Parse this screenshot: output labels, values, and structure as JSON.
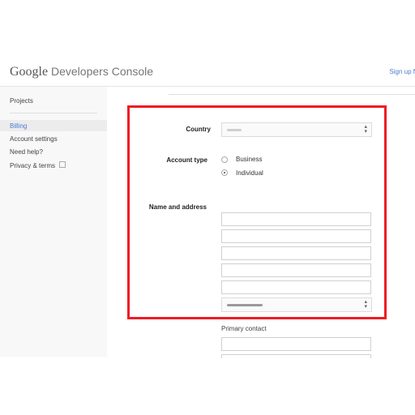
{
  "header": {
    "brand_google": "Google",
    "brand_rest": " Developers Console",
    "signup": "Sign up f"
  },
  "sidebar": {
    "items": [
      {
        "label": "Projects"
      },
      {
        "label": "Billing"
      },
      {
        "label": "Account settings"
      },
      {
        "label": "Need help?"
      },
      {
        "label": "Privacy & terms"
      }
    ],
    "active": "Billing"
  },
  "form": {
    "country_label": "Country",
    "country_value": "",
    "account_type_label": "Account type",
    "account_types": [
      {
        "label": "Business",
        "checked": false
      },
      {
        "label": "Individual",
        "checked": true
      }
    ],
    "name_address_label": "Name and address",
    "address_fields": [
      "",
      "",
      "",
      "",
      ""
    ],
    "state_select_value": "",
    "primary_contact_label": "Primary contact"
  },
  "colors": {
    "highlight": "#ee1c24",
    "link": "#4a7bd0"
  },
  "icons": [
    "external-link-icon",
    "select-arrows-icon"
  ]
}
